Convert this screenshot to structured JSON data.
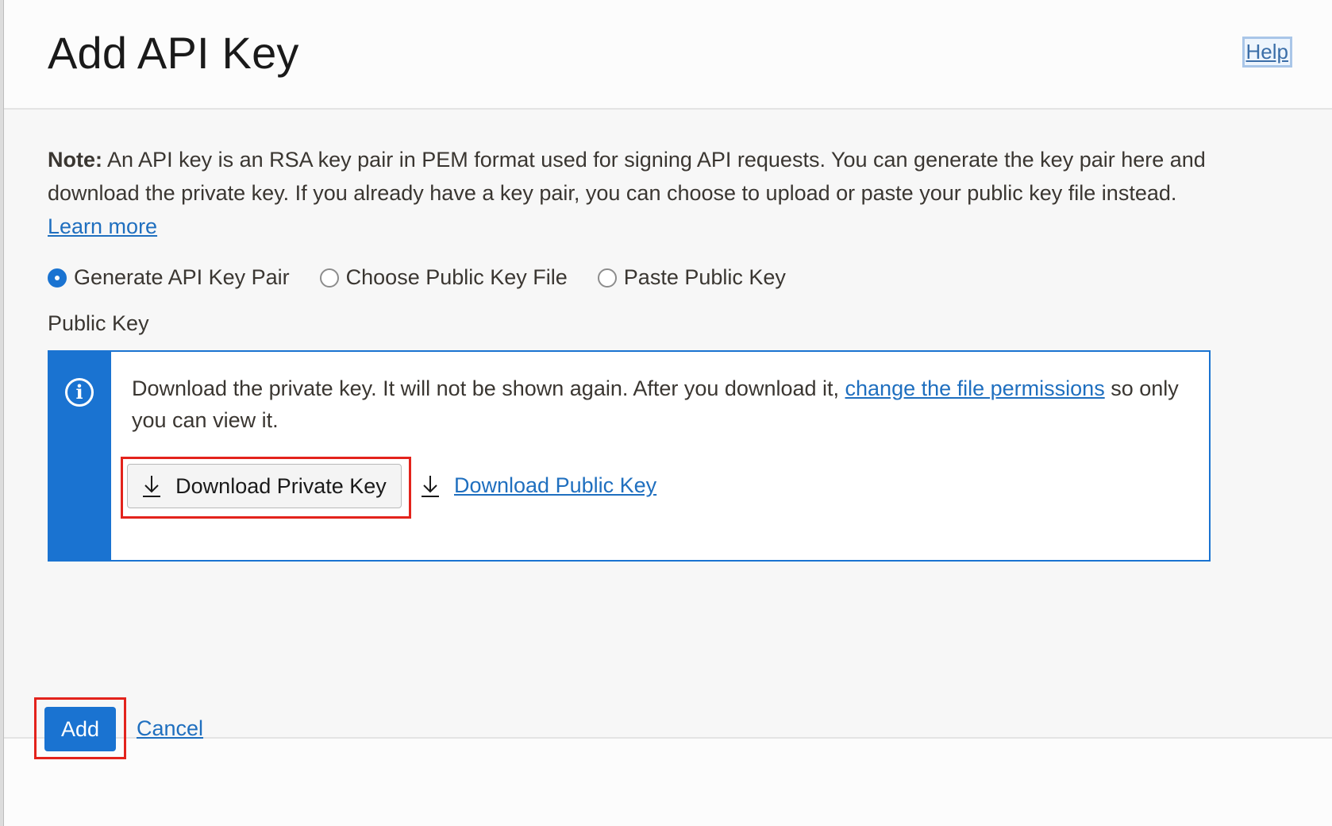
{
  "header": {
    "title": "Add API Key",
    "help_label": "Help"
  },
  "note": {
    "label": "Note:",
    "text": " An API key is an RSA key pair in PEM format used for signing API requests. You can generate the key pair here and download the private key. If you already have a key pair, you can choose to upload or paste your public key file instead. ",
    "learn_more": "Learn more"
  },
  "key_options": {
    "selected": "Generate API Key Pair",
    "options": [
      "Generate API Key Pair",
      "Choose Public Key File",
      "Paste Public Key"
    ]
  },
  "public_key_section": {
    "label": "Public Key",
    "info_text_before": "Download the private key. It will not be shown again. After you download it, ",
    "info_link": "change the file permissions",
    "info_text_after": " so only you can view it.",
    "download_private_label": "Download Private Key",
    "download_public_label": "Download Public Key"
  },
  "footer": {
    "add_label": "Add",
    "cancel_label": "Cancel"
  },
  "colors": {
    "accent": "#1a73d1",
    "link": "#1f6fbf",
    "highlight": "#e3231c"
  },
  "icons": {
    "info": "info-circle-icon",
    "download": "download-arrow-icon"
  }
}
